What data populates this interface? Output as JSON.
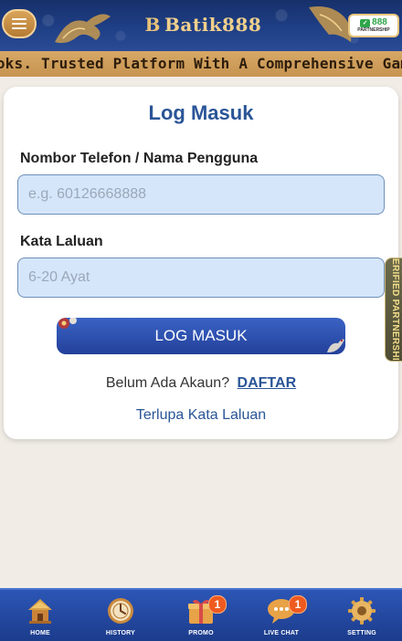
{
  "header": {
    "logo_mark": "B",
    "logo_text": "Batik888",
    "partner_num": "888",
    "partner_label": "PARTNERSHIP"
  },
  "marquee": {
    "text": "ooks. Trusted Platform With A Comprehensive Gam"
  },
  "login": {
    "title": "Log Masuk",
    "username_label": "Nombor Telefon / Nama Pengguna",
    "username_placeholder": "e.g. 60126668888",
    "username_value": "",
    "password_label": "Kata Laluan",
    "password_placeholder": "6-20 Ayat",
    "password_value": "",
    "submit_label": "LOG MASUK",
    "signup_prompt": "Belum Ada Akaun?",
    "signup_link": "DAFTAR",
    "forgot_link": "Terlupa Kata Laluan"
  },
  "side_tab": {
    "text": "VERIFIED PARTNERSHIP"
  },
  "bottom_nav": {
    "items": [
      {
        "label": "HOME",
        "icon": "temple-home-icon"
      },
      {
        "label": "HISTORY",
        "icon": "clock-history-icon"
      },
      {
        "label": "PROMO",
        "icon": "gift-box-icon",
        "badge": "1"
      },
      {
        "label": "LIVE CHAT",
        "icon": "chat-bubble-icon",
        "badge": "1"
      },
      {
        "label": "SETTING",
        "icon": "gear-icon"
      }
    ]
  },
  "colors": {
    "header_bg": "#1f3f86",
    "marquee_bg": "#d7a866",
    "accent_blue": "#2a5597",
    "input_bg": "#d5e6fb",
    "badge": "#ef5a1f"
  }
}
